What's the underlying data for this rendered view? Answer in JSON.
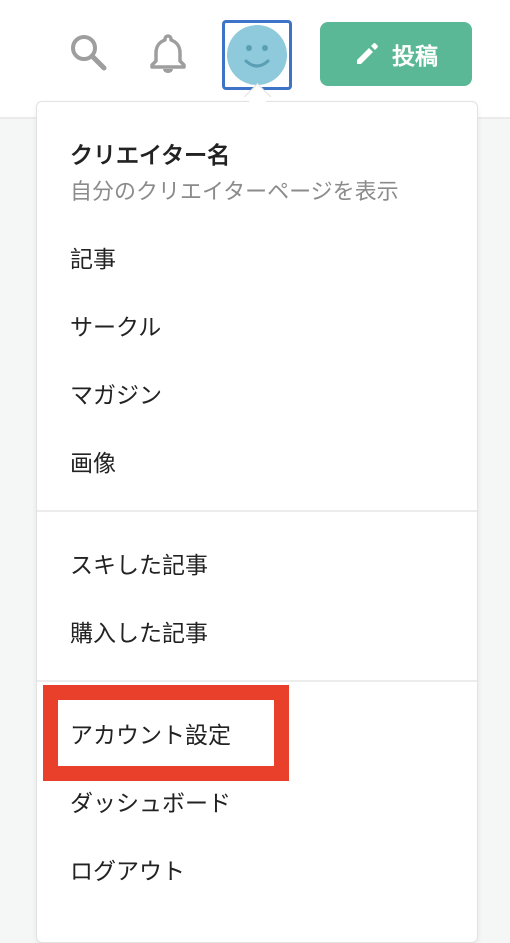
{
  "header": {
    "post_label": "投稿",
    "accent_color": "#5bb896",
    "icons": [
      "search-icon",
      "bell-icon",
      "avatar-smiley-icon",
      "pencil-icon"
    ]
  },
  "menu": {
    "creator_name": "クリエイター名",
    "creator_subtitle": "自分のクリエイターページを表示",
    "items": [
      {
        "label": "記事"
      },
      {
        "label": "サークル"
      },
      {
        "label": "マガジン"
      },
      {
        "label": "画像"
      },
      {
        "label": "スキした記事"
      },
      {
        "label": "購入した記事"
      },
      {
        "label": "アカウント設定"
      },
      {
        "label": "ダッシュボード"
      },
      {
        "label": "ログアウト"
      }
    ]
  },
  "annotation": {
    "highlight_color": "#e8402a",
    "highlighted_item": "アカウント設定"
  }
}
